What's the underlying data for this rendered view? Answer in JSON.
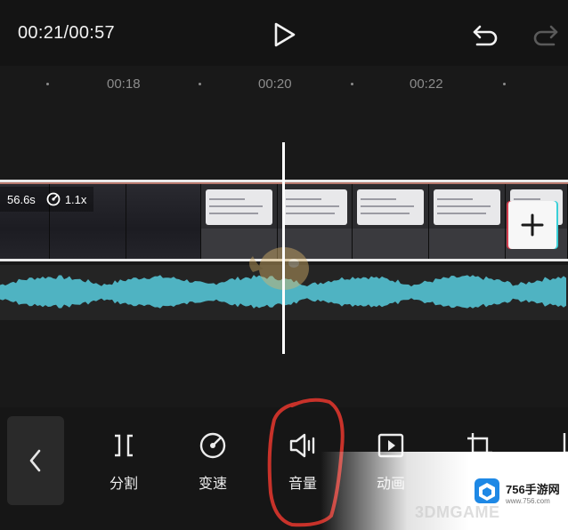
{
  "header": {
    "timecode": "00:21/00:57",
    "play_icon": "play-icon",
    "undo_icon": "undo-icon",
    "redo_icon": "redo-icon"
  },
  "ruler": {
    "labels": [
      "00:18",
      "00:20",
      "00:22"
    ]
  },
  "clip": {
    "duration": "56.6s",
    "speed": "1.1x",
    "speed_icon": "speed-gauge-icon",
    "add_icon": "plus-icon"
  },
  "audio": {
    "waveform_color": "#4fb3c2"
  },
  "toolbar": {
    "back_icon": "chevron-left-icon",
    "tools": [
      {
        "label": "分割",
        "icon": "split-icon"
      },
      {
        "label": "变速",
        "icon": "speed-icon"
      },
      {
        "label": "音量",
        "icon": "volume-icon"
      },
      {
        "label": "动画",
        "icon": "animation-icon"
      }
    ]
  },
  "watermark": {
    "site": "756手游网",
    "url": "www.756.com",
    "brand": "3DMGAME"
  },
  "colors": {
    "background": "#141414",
    "annotation": "#c8322a",
    "waveform": "#4fb3c2",
    "playhead": "#ffffff"
  }
}
